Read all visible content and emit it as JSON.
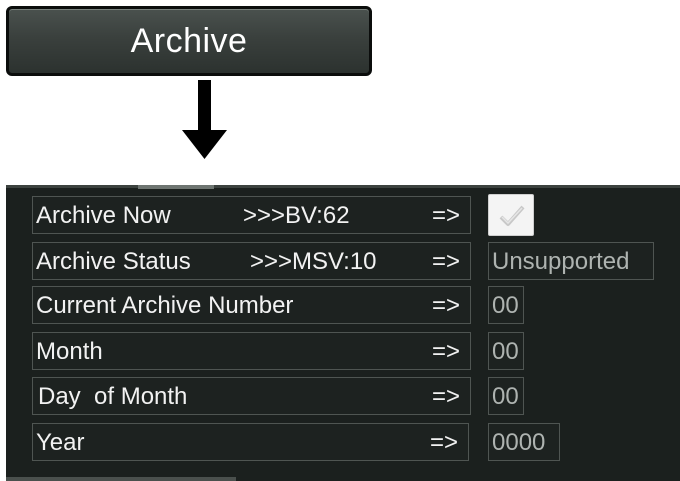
{
  "archive_button": {
    "label": "Archive"
  },
  "rows": [
    {
      "label": "Archive Now",
      "ref": ">>>BV:62",
      "arrow": "=>",
      "value_type": "checkbox",
      "checked": true
    },
    {
      "label": "Archive Status",
      "ref": ">>>MSV:10",
      "arrow": "=>",
      "value": "Unsupported"
    },
    {
      "label": "Current Archive Number",
      "arrow": "=>",
      "value": "00"
    },
    {
      "label": "Month",
      "arrow": "=>",
      "value": "00"
    },
    {
      "label": "Day  of Month",
      "arrow": "=>",
      "value": "00"
    },
    {
      "label": "Year",
      "arrow": "=>",
      "value": "0000"
    }
  ],
  "icons": {
    "arrow": "arrow-down-icon",
    "checkmark": "checkmark-icon"
  },
  "colors": {
    "panel_background": "#1b201e",
    "text": "#f2f2f2",
    "value_text": "#aeb3b0"
  }
}
